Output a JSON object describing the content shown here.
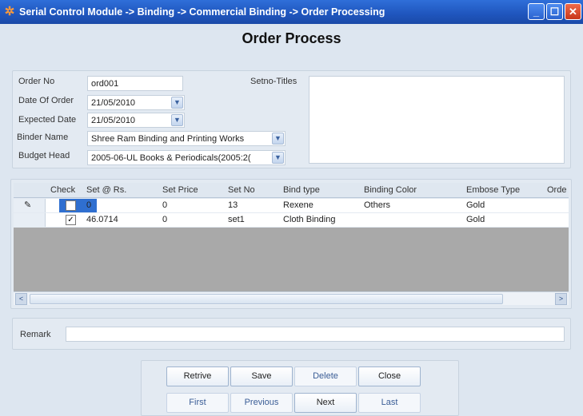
{
  "window": {
    "title": "Serial Control Module -> Binding -> Commercial Binding -> Order Processing",
    "min_glyph": "_",
    "max_glyph": "☐",
    "close_glyph": "✕"
  },
  "heading": "Order Process",
  "form": {
    "order_no_label": "Order No",
    "order_no_value": "ord001",
    "date_of_order_label": "Date Of Order",
    "date_of_order_value": "21/05/2010",
    "expected_date_label": "Expected Date",
    "expected_date_value": "21/05/2010",
    "binder_name_label": "Binder Name",
    "binder_name_value": "Shree Ram Binding and Printing Works",
    "budget_head_label": "Budget Head",
    "budget_head_value": "2005-06-UL Books & Periodicals(2005:2(",
    "setno_titles_label": "Setno-Titles",
    "setno_titles_value": ""
  },
  "grid": {
    "columns": [
      "Check",
      "Set @ Rs.",
      "Set Price",
      "Set No",
      "Bind type",
      "Binding Color",
      "Embose Type",
      "Orde"
    ],
    "rows": [
      {
        "check": "",
        "set_rs": "0",
        "set_price": "0",
        "set_no": "13",
        "bind_type": "Rexene",
        "binding_color": "Others",
        "embose_type": "Gold",
        "editing_glyph": "✎"
      },
      {
        "check": "✓",
        "set_rs": "46.0714",
        "set_price": "0",
        "set_no": "set1",
        "bind_type": "Cloth Binding",
        "binding_color": "",
        "embose_type": "Gold",
        "editing_glyph": ""
      }
    ],
    "scroll_left": "<",
    "scroll_right": ">"
  },
  "remark": {
    "label": "Remark",
    "value": ""
  },
  "buttons": {
    "retrive": "Retrive",
    "save": "Save",
    "delete": "Delete",
    "close": "Close",
    "first": "First",
    "previous": "Previous",
    "next": "Next",
    "last": "Last"
  },
  "icons": {
    "dropdown": "chevron-down-icon",
    "app": "app-star-icon"
  },
  "colors": {
    "titlebar": "#1f55bd",
    "selected_cell": "#2f6fd0",
    "empty_grid": "#a9a9a9",
    "accent_text": "#3a5d96"
  }
}
